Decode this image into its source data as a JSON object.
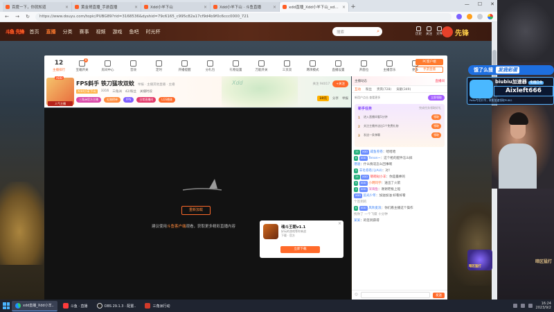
{
  "browser": {
    "tabs": [
      {
        "label": "百度一下，你就知道"
      },
      {
        "label": "黄金哥直播_手游直播"
      },
      {
        "label": "Xdd小羊下山"
      },
      {
        "label": "Xdd小羊下山 · 斗鱼直播"
      },
      {
        "label": "xdd直播_Xdd小羊下山_xddfps"
      }
    ],
    "url": "https://www.douyu.com/topic/PUBG89?rid=3168536&dyshid=79c6165_c995c82a17cf9d4b9f0c6ccc0000_721"
  },
  "site": {
    "logo_main": "斗鱼",
    "logo_sub": "先锋",
    "nav": [
      "首页",
      "直播",
      "分类",
      "赛事",
      "视频",
      "游戏",
      "鱼吧",
      "时光杯"
    ],
    "search_placeholder": "搜索",
    "header_icons": [
      "历史",
      "关注",
      "文件"
    ],
    "badge": "先锋"
  },
  "room_nav": {
    "rank_num": "12",
    "rank_label": "主播排行",
    "items": [
      {
        "label": "宝箱开关",
        "badge": "8"
      },
      {
        "label": "房间中心"
      },
      {
        "label": "音效"
      },
      {
        "label": "定时"
      },
      {
        "label": "开播提醒"
      },
      {
        "label": "分礼包"
      },
      {
        "label": "礼物设置"
      },
      {
        "label": "万能开关"
      },
      {
        "label": "三页双"
      },
      {
        "label": "两项模式"
      },
      {
        "label": "直播设置"
      },
      {
        "label": "开座位"
      },
      {
        "label": "主播音乐"
      },
      {
        "label": "更多"
      }
    ],
    "pc_btn": "PC客户端",
    "pc_btn2": "手游直播"
  },
  "stream_info": {
    "avatar_tag": "XDD",
    "avatar_level": "人气主播",
    "title": "FPS斜手 铁刀猛攻双蚊",
    "title_extra": "举报 · 主播其他直播 · 主播",
    "meta": [
      "Xdd小羊下山",
      "3316",
      "三角洲",
      "42/粉丝",
      "关播时段"
    ],
    "chips": [
      "三角洲官方主播",
      "礼物榜单",
      "FPS",
      "日常直播间",
      "LGS教练"
    ],
    "fans": "关注 94017",
    "follow": "+关注",
    "promo_text": "分享",
    "promo_coin": "10元",
    "promo_share": "举报"
  },
  "player": {
    "play_btn": "重新加载",
    "hint_pre": "建议使用",
    "hint_link": "斗鱼客户端",
    "hint_post": "观看，获取更多精彩直播内容",
    "ad": {
      "close": "×",
      "title": "魂斗王朝v1.1",
      "desc1": "好玩的游戏等你来战",
      "desc2": "下载 · 官方",
      "download": "立即下载"
    }
  },
  "chat": {
    "top_left": "主播动态",
    "top_right": "直播间",
    "tabs": [
      "互动",
      "粉丝",
      "贵宾(728)",
      "贡献(349)"
    ],
    "notice": "新用户点击 查看更多",
    "notice_btn": "立即领取",
    "quest_title": "新手任务",
    "quest_sub": "完成任务领取好礼",
    "quests": [
      {
        "num": "1",
        "text": "进入直播间看5分钟",
        "btn": "领取"
      },
      {
        "num": "2",
        "text": "关注主播并送出1个免费礼物",
        "btn": "领取"
      },
      {
        "num": "3",
        "text": "发送一条弹幕",
        "btn": "领取"
      }
    ],
    "messages": [
      {
        "lv": "12",
        "fan": "XDD",
        "name": "咸鱼卷卷",
        "text": "：哈哈哈",
        "style": "nm"
      },
      {
        "lv": "8",
        "fan": "XDD",
        "name": "Tenon~",
        "text": "：这个枪的配件怎么搞",
        "style": "nm"
      },
      {
        "lv": "",
        "fan": "",
        "name": "港速",
        "text": "：什么情况怎么回事啊",
        "style": "nm"
      },
      {
        "lv": "5",
        "fan": "",
        "name": "羊毛卷卷儿(AU)",
        "text": "：对！",
        "style": "nm"
      },
      {
        "lv": "15",
        "fan": "XDD",
        "name": "萌萌哒小羊",
        "text": "：你是最棒的",
        "style": "red"
      },
      {
        "lv": "9",
        "fan": "XDD",
        "name": "小明同学",
        "text": "：送出了火箭",
        "style": "ora"
      },
      {
        "lv": "3",
        "fan": "XDD",
        "name": "深海鱼",
        "text": "：谢谢老板上船",
        "style": "pk"
      },
      {
        "lv": "",
        "fan": "XDD",
        "name": "追光少年",
        "text": "：加油加油 好看好看",
        "style": "nm"
      },
      {
        "lv": "",
        "fan": "",
        "name": "个签到的",
        "text": "",
        "style": "sys"
      },
      {
        "lv": "6",
        "fan": "XDD",
        "name": "风吹麦浪",
        "text": "：你们看主播这个操作",
        "style": "nm"
      },
      {
        "lv": "",
        "fan": "",
        "name": "找你了 一个飞碟 十分钟",
        "text": "",
        "style": "sys"
      },
      {
        "lv": "",
        "fan": "",
        "name": "某某",
        "text": "：的签到获得",
        "style": "nm"
      }
    ],
    "input_send": "发送"
  },
  "overlay": {
    "ad_line_prefix": "饿了么搜",
    "ad_line_hl": "发我彩蛋",
    "bb_name": "biubiu加速器",
    "bb_small": "专用口令",
    "bb_user": "Aixleft666",
    "bb_sub": "PaKo专用口令，联影加速领取PUBG",
    "game_icon": "暗区猛打",
    "room_deco": "暗区猛打"
  },
  "taskbar": {
    "items": [
      {
        "label": "xdd直播_Xdd小羊..",
        "icon": "edge",
        "active": true
      },
      {
        "label": "斗鱼 · 直播",
        "icon": "red"
      },
      {
        "label": "OBS 29.1.3 · 配置..",
        "icon": "obs"
      },
      {
        "label": "三角洲行动",
        "icon": "game"
      }
    ],
    "time": "16:24",
    "date": "2023/9/2"
  }
}
